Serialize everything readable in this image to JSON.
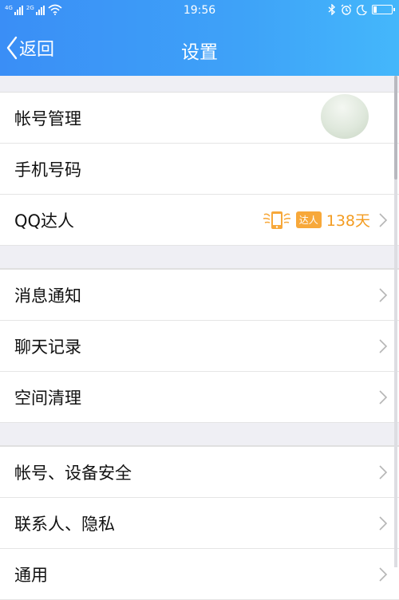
{
  "status_bar": {
    "net1": "4G",
    "net2": "2G",
    "time": "19:56",
    "battery_level": 0.2
  },
  "nav": {
    "back_label": "返回",
    "title": "设置"
  },
  "groups": [
    {
      "items": [
        {
          "label": "帐号管理",
          "trailing": "avatar"
        },
        {
          "label": "手机号码",
          "trailing": "none"
        },
        {
          "label": "QQ达人",
          "trailing": "daren",
          "badge": "达人",
          "value": "138天"
        }
      ]
    },
    {
      "items": [
        {
          "label": "消息通知"
        },
        {
          "label": "聊天记录"
        },
        {
          "label": "空间清理"
        }
      ]
    },
    {
      "items": [
        {
          "label": "帐号、设备安全"
        },
        {
          "label": "联系人、隐私"
        },
        {
          "label": "通用"
        }
      ]
    }
  ],
  "colors": {
    "header_start": "#3a8ef6",
    "header_end": "#44b7fb",
    "accent_orange": "#f39c21",
    "background": "#efeff4"
  }
}
